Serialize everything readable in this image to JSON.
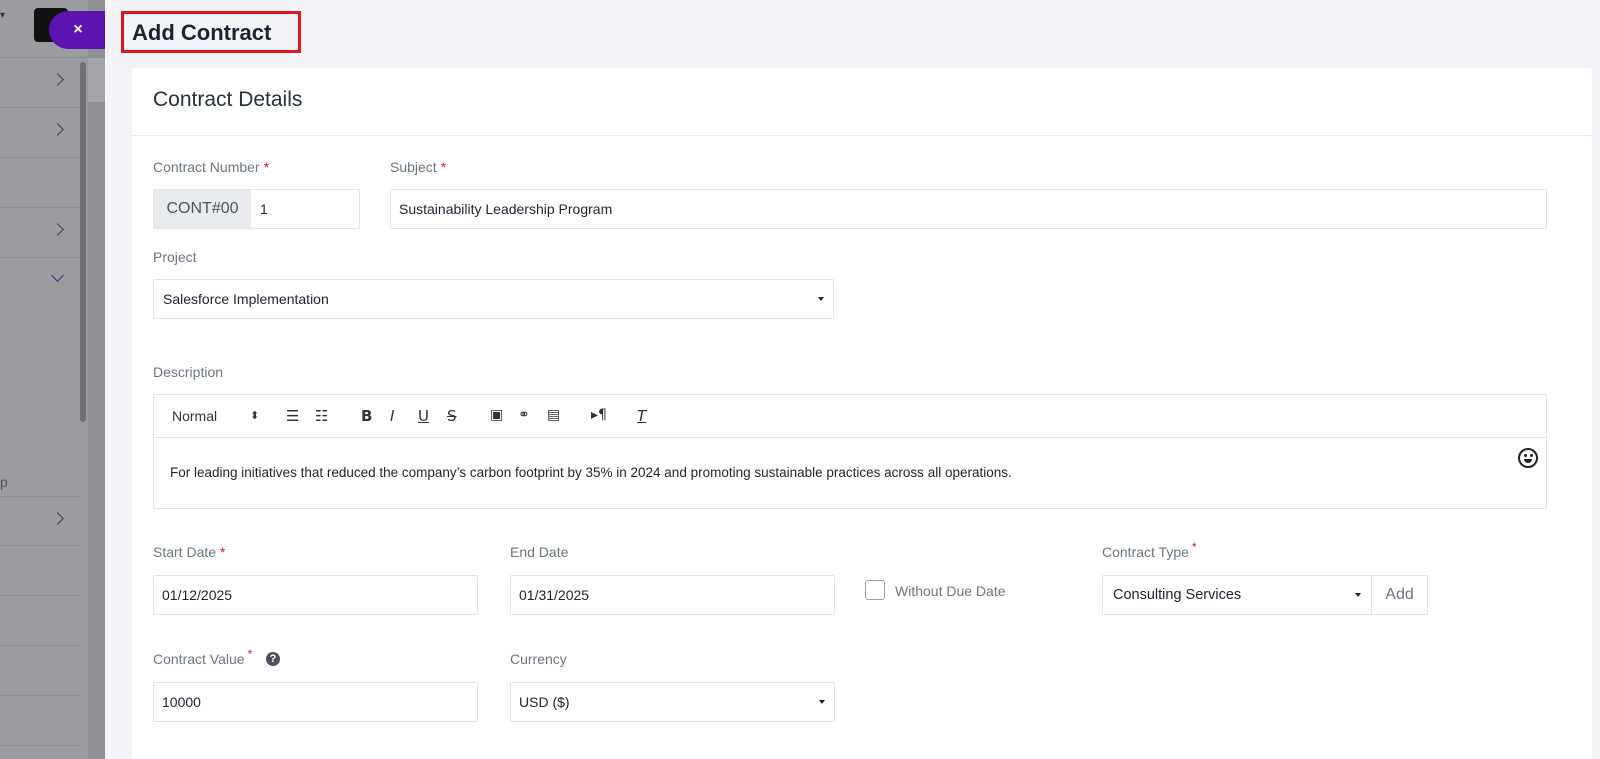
{
  "sidebar": {
    "partial_text": "p"
  },
  "close_label": "×",
  "page_title": "Add Contract",
  "card_title": "Contract Details",
  "form": {
    "contract_number": {
      "label": "Contract Number",
      "required": "*",
      "prefix": "CONT#00",
      "value": "1"
    },
    "subject": {
      "label": "Subject",
      "required": "*",
      "value": "Sustainability Leadership Program"
    },
    "project": {
      "label": "Project",
      "value": "Salesforce Implementation"
    },
    "description": {
      "label": "Description",
      "toolbar": {
        "format": "Normal"
      },
      "value": "For leading initiatives that reduced the company’s carbon footprint by 35% in 2024 and promoting sustainable practices across all operations."
    },
    "start_date": {
      "label": "Start Date",
      "required": "*",
      "value": "01/12/2025"
    },
    "end_date": {
      "label": "End Date",
      "value": "01/31/2025"
    },
    "without_due_date": {
      "label": "Without Due Date",
      "checked": false
    },
    "contract_type": {
      "label": "Contract Type",
      "required": "*",
      "value": "Consulting Services",
      "add_label": "Add"
    },
    "contract_value": {
      "label": "Contract Value",
      "required": "*",
      "value": "10000"
    },
    "currency": {
      "label": "Currency",
      "value": "USD ($)"
    }
  },
  "icons": [
    "close-icon",
    "chevron-right-icon",
    "chevron-down-icon",
    "help-icon",
    "ordered-list-icon",
    "bullet-list-icon",
    "bold-icon",
    "italic-icon",
    "underline-icon",
    "strike-icon",
    "image-icon",
    "link-icon",
    "video-icon",
    "rtl-icon",
    "clear-format-icon",
    "emoji-icon"
  ],
  "colors": {
    "accent": "#5b14b0",
    "required": "#e3141b",
    "highlight_border": "#e3141b"
  }
}
